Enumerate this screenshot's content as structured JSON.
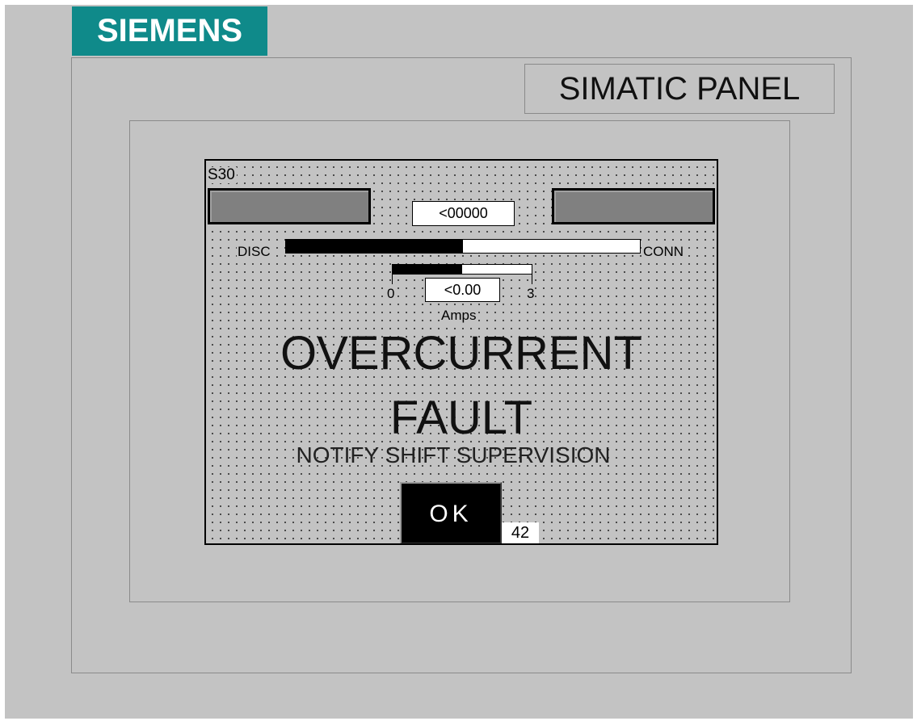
{
  "brand": {
    "logo_text": "SIEMENS",
    "logo_color": "#0f8a8a"
  },
  "panel": {
    "model_label": "SIMATIC PANEL"
  },
  "screen": {
    "id": "S30",
    "counter_value": "<00000",
    "position_bar": {
      "left_label": "DISC",
      "right_label": "CONN",
      "fill_fraction": 0.5
    },
    "current_bar": {
      "min_label": "0",
      "max_label": "3",
      "fill_fraction": 0.5,
      "value": "<0.00",
      "unit": "Amps"
    },
    "alarm": {
      "title_line1": "OVERCURRENT",
      "title_line2": "FAULT",
      "message": "NOTIFY SHIFT SUPERVISION"
    },
    "ok_button": {
      "label": "OK"
    },
    "tag_number": "42"
  }
}
